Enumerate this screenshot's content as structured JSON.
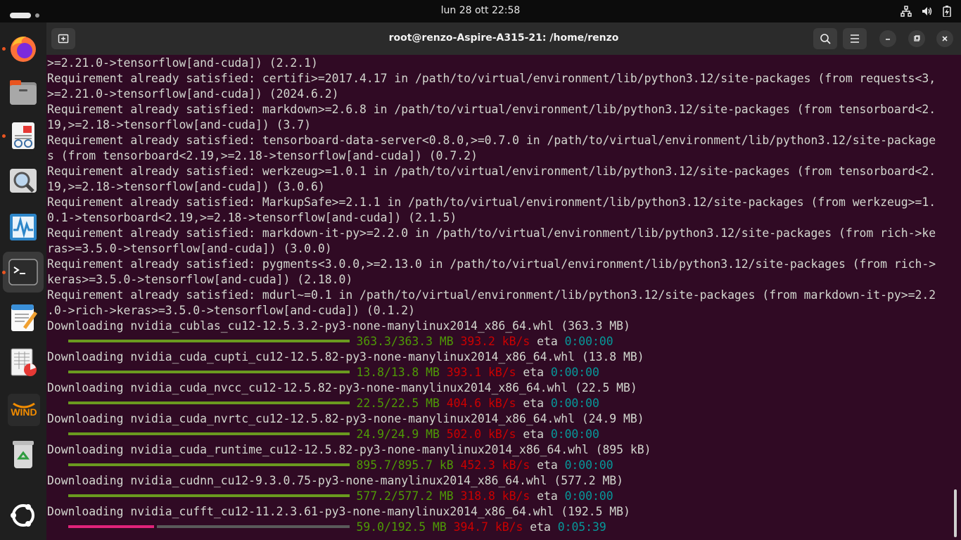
{
  "topbar": {
    "clock": "lun 28 ott  22:58",
    "tray_icons": [
      "network-icon",
      "volume-icon",
      "battery-icon"
    ]
  },
  "dock": {
    "items": [
      {
        "name": "firefox",
        "icon": "firefox-icon",
        "color": "#ff7139",
        "running": true
      },
      {
        "name": "files",
        "icon": "folder-icon",
        "color": "#8f8f8f",
        "running": false
      },
      {
        "name": "document-viewer",
        "icon": "document-viewer-icon",
        "color": "#e6e6e6",
        "running": true
      },
      {
        "name": "search",
        "icon": "search-tool-icon",
        "color": "#d9d9d9",
        "running": false
      },
      {
        "name": "system-monitor",
        "icon": "system-monitor-icon",
        "color": "#2d86c9",
        "running": false
      },
      {
        "name": "terminal",
        "icon": "terminal-icon",
        "color": "#3b3b3b",
        "running": true
      },
      {
        "name": "text-editor",
        "icon": "text-editor-icon",
        "color": "#3a8fd8",
        "running": false
      },
      {
        "name": "spreadsheet",
        "icon": "spreadsheet-icon",
        "color": "#e8e8e8",
        "running": false
      },
      {
        "name": "wind",
        "icon": "wind-logo-icon",
        "color": "#f28c00",
        "running": false,
        "label": "WIND"
      },
      {
        "name": "trash",
        "icon": "trash-icon",
        "color": "#d9d9d9",
        "running": false
      },
      {
        "name": "show-apps",
        "icon": "ubuntu-apps-icon",
        "color": "#ffffff",
        "running": false
      }
    ]
  },
  "window": {
    "title": "root@renzo-Aspire-A315-21: /home/renzo",
    "new_tab_icon": "new-tab-icon",
    "search_icon": "search-icon",
    "menu_icon": "hamburger-menu-icon",
    "minimize_icon": "minimize-icon",
    "maximize_icon": "maximize-icon",
    "close_icon": "close-icon"
  },
  "terminal": {
    "colors": {
      "background": "#300a24",
      "text": "#d3d7cf",
      "size": "#4e9a06",
      "speed": "#cc0000",
      "eta": "#06989a",
      "done_bar": "#6a9a1f",
      "progress_bar": "#e0237a"
    },
    "text_lines": [
      ">=2.21.0->tensorflow[and-cuda]) (2.2.1)",
      "Requirement already satisfied: certifi>=2017.4.17 in /path/to/virtual/environment/lib/python3.12/site-packages (from requests<3,",
      ">=2.21.0->tensorflow[and-cuda]) (2024.6.2)",
      "Requirement already satisfied: markdown>=2.6.8 in /path/to/virtual/environment/lib/python3.12/site-packages (from tensorboard<2.",
      "19,>=2.18->tensorflow[and-cuda]) (3.7)",
      "Requirement already satisfied: tensorboard-data-server<0.8.0,>=0.7.0 in /path/to/virtual/environment/lib/python3.12/site-package",
      "s (from tensorboard<2.19,>=2.18->tensorflow[and-cuda]) (0.7.2)",
      "Requirement already satisfied: werkzeug>=1.0.1 in /path/to/virtual/environment/lib/python3.12/site-packages (from tensorboard<2.",
      "19,>=2.18->tensorflow[and-cuda]) (3.0.6)",
      "Requirement already satisfied: MarkupSafe>=2.1.1 in /path/to/virtual/environment/lib/python3.12/site-packages (from werkzeug>=1.",
      "0.1->tensorboard<2.19,>=2.18->tensorflow[and-cuda]) (2.1.5)",
      "Requirement already satisfied: markdown-it-py>=2.2.0 in /path/to/virtual/environment/lib/python3.12/site-packages (from rich->ke",
      "ras>=3.5.0->tensorflow[and-cuda]) (3.0.0)",
      "Requirement already satisfied: pygments<3.0.0,>=2.13.0 in /path/to/virtual/environment/lib/python3.12/site-packages (from rich->",
      "keras>=3.5.0->tensorflow[and-cuda]) (2.18.0)",
      "Requirement already satisfied: mdurl~=0.1 in /path/to/virtual/environment/lib/python3.12/site-packages (from markdown-it-py>=2.2",
      ".0->rich->keras>=3.5.0->tensorflow[and-cuda]) (0.1.2)"
    ],
    "downloads": [
      {
        "line": "Downloading nvidia_cublas_cu12-12.5.3.2-py3-none-manylinux2014_x86_64.whl (363.3 MB)",
        "size": "363.3/363.3 MB",
        "speed": "393.2 kB/s",
        "eta_label": "eta",
        "eta": "0:00:00",
        "progress": 1.0
      },
      {
        "line": "Downloading nvidia_cuda_cupti_cu12-12.5.82-py3-none-manylinux2014_x86_64.whl (13.8 MB)",
        "size": "13.8/13.8 MB",
        "speed": "393.1 kB/s",
        "eta_label": "eta",
        "eta": "0:00:00",
        "progress": 1.0
      },
      {
        "line": "Downloading nvidia_cuda_nvcc_cu12-12.5.82-py3-none-manylinux2014_x86_64.whl (22.5 MB)",
        "size": "22.5/22.5 MB",
        "speed": "404.6 kB/s",
        "eta_label": "eta",
        "eta": "0:00:00",
        "progress": 1.0
      },
      {
        "line": "Downloading nvidia_cuda_nvrtc_cu12-12.5.82-py3-none-manylinux2014_x86_64.whl (24.9 MB)",
        "size": "24.9/24.9 MB",
        "speed": "502.0 kB/s",
        "eta_label": "eta",
        "eta": "0:00:00",
        "progress": 1.0
      },
      {
        "line": "Downloading nvidia_cuda_runtime_cu12-12.5.82-py3-none-manylinux2014_x86_64.whl (895 kB)",
        "size": "895.7/895.7 kB",
        "speed": "452.3 kB/s",
        "eta_label": "eta",
        "eta": "0:00:00",
        "progress": 1.0
      },
      {
        "line": "Downloading nvidia_cudnn_cu12-9.3.0.75-py3-none-manylinux2014_x86_64.whl (577.2 MB)",
        "size": "577.2/577.2 MB",
        "speed": "318.8 kB/s",
        "eta_label": "eta",
        "eta": "0:00:00",
        "progress": 1.0
      },
      {
        "line": "Downloading nvidia_cufft_cu12-11.2.3.61-py3-none-manylinux2014_x86_64.whl (192.5 MB)",
        "size": "59.0/192.5 MB",
        "speed": "394.7 kB/s",
        "eta_label": "eta",
        "eta": "0:05:39",
        "progress": 0.306
      }
    ]
  }
}
